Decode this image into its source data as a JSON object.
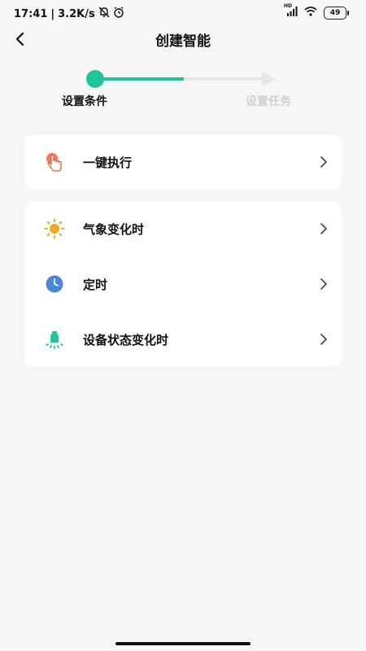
{
  "status_bar": {
    "time": "17:41",
    "network_speed": "3.2K/s",
    "signal_label": "HD",
    "battery": "49",
    "icons": [
      "mute-icon",
      "alarm-icon",
      "signal-icon",
      "wifi-icon",
      "battery-icon"
    ]
  },
  "header": {
    "title": "创建智能",
    "back_icon": "chevron-left-icon"
  },
  "stepper": {
    "active_color": "#21c59b",
    "inactive_color": "#e6e6e6",
    "steps": [
      {
        "label": "设置条件",
        "state": "active"
      },
      {
        "label": "设置任务",
        "state": "inactive"
      }
    ]
  },
  "conditions": {
    "group1": [
      {
        "label": "一键执行",
        "icon": "tap-hand-icon"
      }
    ],
    "group2": [
      {
        "label": "气象变化时",
        "icon": "sun-icon"
      },
      {
        "label": "定时",
        "icon": "clock-icon"
      },
      {
        "label": "设备状态变化时",
        "icon": "device-bulb-icon"
      }
    ]
  }
}
